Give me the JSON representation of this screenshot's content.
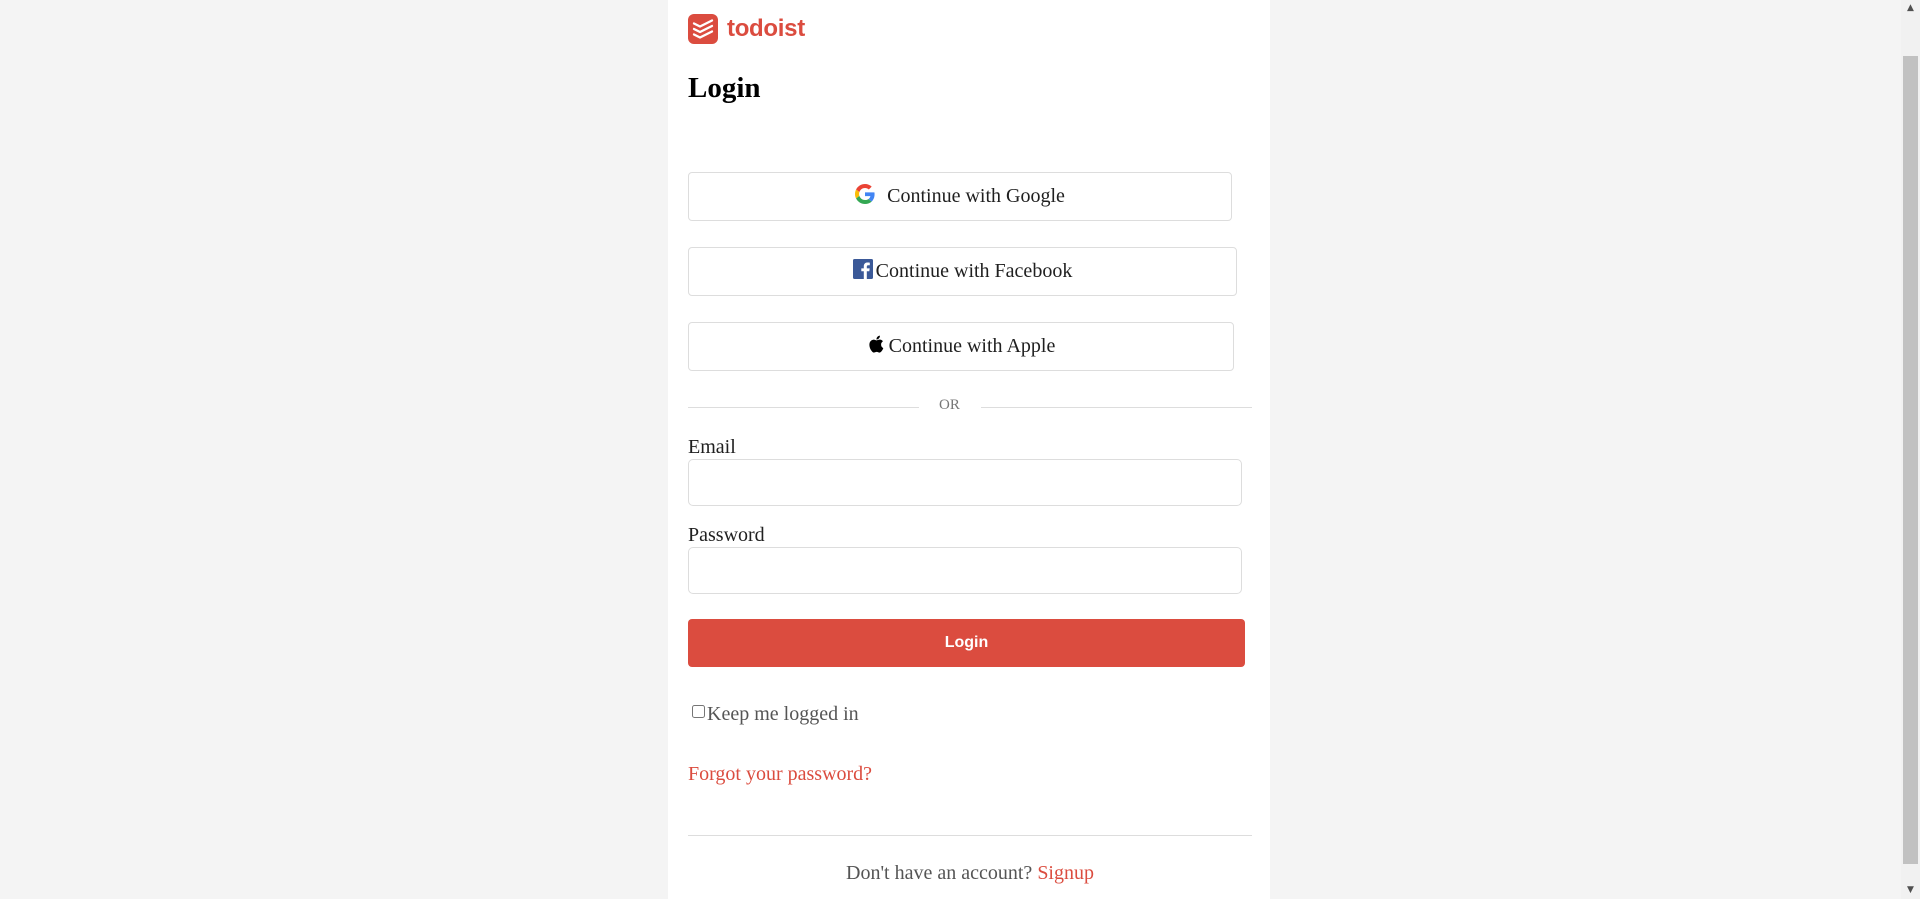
{
  "brand": {
    "name": "todoist",
    "color": "#db4c3f"
  },
  "title": "Login",
  "social": {
    "google": "Continue with Google",
    "facebook": "Continue with Facebook",
    "apple": "Continue with Apple"
  },
  "divider": "OR",
  "form": {
    "email_label": "Email",
    "email_value": "",
    "password_label": "Password",
    "password_value": "",
    "login_label": "Login",
    "keep_logged_in": "Keep me logged in",
    "keep_logged_in_checked": false,
    "forgot_password": "Forgot your password?"
  },
  "footer": {
    "no_account": "Don't have an account?",
    "signup": "Signup"
  },
  "icons": {
    "logo": "todoist-logo-icon",
    "google": "google-icon",
    "facebook": "facebook-icon",
    "apple": "apple-icon"
  }
}
